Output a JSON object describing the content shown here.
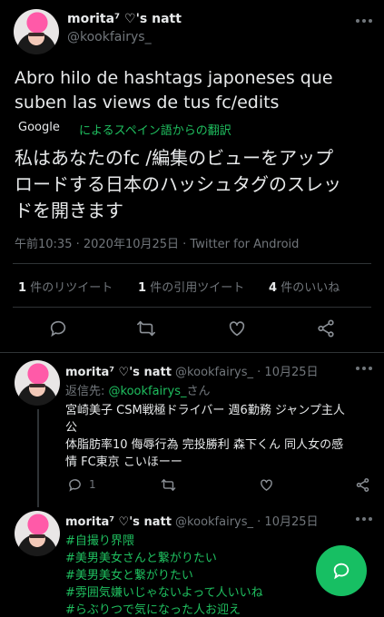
{
  "main_tweet": {
    "display_name": "morita⁷ ♡'s natt",
    "handle": "@kookfairys_",
    "text_line1": "Abro hilo de hashtags japoneses  que",
    "text_line2": "suben las views de tus fc/edits",
    "translation_provider": "Google",
    "translation_note": "によるスペイン語からの翻訳",
    "translated_line1": "私はあなたのfc /編集のビューをアップ",
    "translated_line2": "ロードする日本のハッシュタグのスレッ",
    "translated_line3": "ドを開きます",
    "timestamp": "午前10:35 · 2020年10月25日 · Twitter for Android",
    "retweets_count": "1",
    "retweets_label": "件のリツイート",
    "quotes_count": "1",
    "quotes_label": "件の引用ツイート",
    "likes_count": "4",
    "likes_label": "件のいいね"
  },
  "reply1": {
    "display_name": "morita⁷ ♡'s natt",
    "handle": "@kookfairys_",
    "date": "· 10月25日",
    "reply_prefix": "返信先: ",
    "reply_to": "@kookfairys_",
    "reply_suffix": "さん",
    "line1": "宮崎美子 CSM戦極ドライバー 週6勤務 ジャンプ主人",
    "line2": "公",
    "line3": "体脂肪率10 侮辱行為 完投勝利 森下くん 同人女の感",
    "line4": "情 FC東京 こいほーー",
    "reply_count": "1"
  },
  "reply2": {
    "display_name": "morita⁷ ♡'s natt",
    "handle": "@kookfairys_",
    "date": "· 10月25日",
    "hashtags": [
      "#自撮り界隈",
      "#美男美女さんと繋がりたい",
      "#美男美女と繋がりたい",
      "#雰囲気嫌いじゃないよって人いいね",
      "#らぶりつで気になった人お迎え"
    ]
  },
  "colors": {
    "background": "#000000",
    "text": "#e7e9ea",
    "muted": "#71767b",
    "green_accent": "#1fbf5f",
    "fab": "#17bf63"
  },
  "icons": [
    "more-icon",
    "reply-icon",
    "retweet-icon",
    "like-icon",
    "share-icon",
    "compose-icon"
  ]
}
